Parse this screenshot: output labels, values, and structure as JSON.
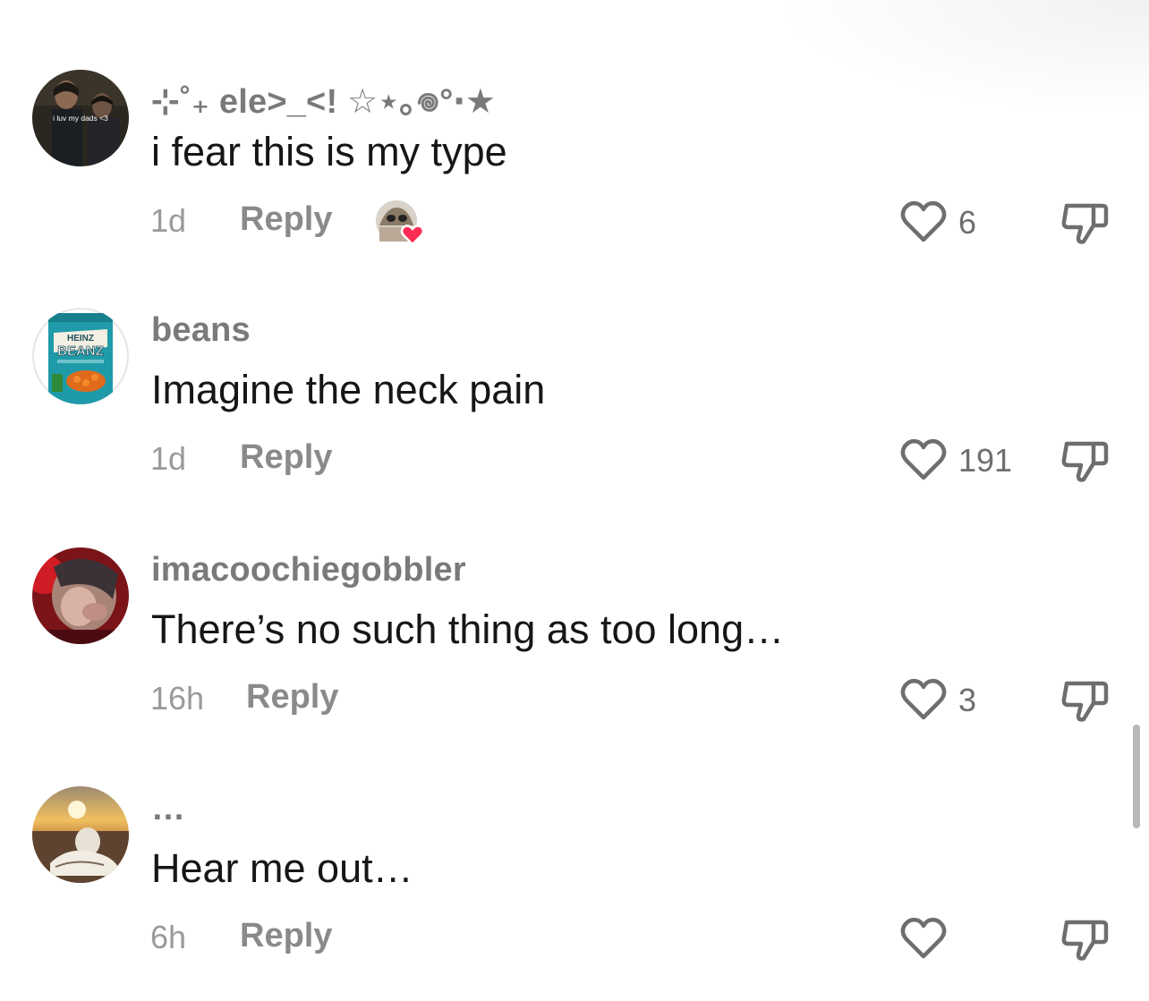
{
  "comments": [
    {
      "username": "⊹˚₊ ele>_<! ☆⋆｡𖦹°‧★",
      "text": "i fear this is my type",
      "time": "1d",
      "reply_label": "Reply",
      "likes": "6",
      "creator_liked": true,
      "avatar_caption": "i luv my dads <3"
    },
    {
      "username": "beans",
      "text": "Imagine the neck pain",
      "time": "1d",
      "reply_label": "Reply",
      "likes": "191",
      "avatar_brand": "HEINZ",
      "avatar_product": "BEANZ"
    },
    {
      "username": "imacoochiegobbler",
      "text": "There’s no such thing as too long…",
      "time": "16h",
      "reply_label": "Reply",
      "likes": "3"
    },
    {
      "username": "…",
      "text": "Hear me out…",
      "time": "6h",
      "reply_label": "Reply",
      "likes": ""
    }
  ],
  "colors": {
    "username": "#7a7a7a",
    "text": "#161616",
    "meta": "#9a9a9a",
    "reply": "#8a8a8a",
    "icon_stroke": "#6e6e6e",
    "creator_heart": "#fe2c55"
  },
  "icons": {
    "like": "heart-outline-icon",
    "dislike": "thumbs-down-icon",
    "creator_like": "heart-filled-icon"
  }
}
